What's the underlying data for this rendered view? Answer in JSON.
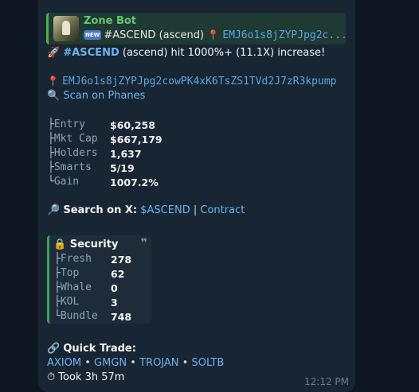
{
  "reply": {
    "bot_name": "Zone Bot",
    "new_badge": "NEW",
    "ticker_text": "#ASCEND (ascend)",
    "address_preview": "EMJ6o1s8jZYPJpg2c..."
  },
  "headline": {
    "rocket": "🚀",
    "ticker": "#ASCEND",
    "text": " (ascend) hit 1000%+ (11.1X) increase!"
  },
  "contract": {
    "pin": "📍",
    "address": "EMJ6o1s8jZYPJpg2cowPK4xK6TsZS1TVd2J7zR3kpump",
    "scan_icon": "🔍",
    "scan_link": "Scan on Phanes"
  },
  "stats": [
    {
      "prefix": "├",
      "key": "Entry",
      "value": "$60,258"
    },
    {
      "prefix": "├",
      "key": "Mkt Cap",
      "value": "$667,179"
    },
    {
      "prefix": "├",
      "key": "Holders",
      "value": "1,637"
    },
    {
      "prefix": "├",
      "key": "Smarts",
      "value": "5/19"
    },
    {
      "prefix": "└",
      "key": "Gain",
      "value": "1007.2%"
    }
  ],
  "search": {
    "icon": "🔎",
    "label": "Search on X:",
    "ticker_link": "$ASCEND",
    "divider": "|",
    "contract_link": "Contract"
  },
  "security": {
    "lock": "🔒",
    "title": "Security",
    "quote_mark": "❞",
    "items": [
      {
        "prefix": "├",
        "key": "Fresh",
        "value": "278"
      },
      {
        "prefix": "├",
        "key": "Top",
        "value": "62"
      },
      {
        "prefix": "├",
        "key": "Whale",
        "value": "0"
      },
      {
        "prefix": "├",
        "key": "KOL",
        "value": "3"
      },
      {
        "prefix": "└",
        "key": "Bundle",
        "value": "748"
      }
    ]
  },
  "quick_trade": {
    "icon": "🔗",
    "title": "Quick Trade:",
    "links": [
      "AXIOM",
      "GMGN",
      "TROJAN",
      "SOLTB"
    ],
    "separator": "•"
  },
  "took": {
    "icon": "⏱",
    "text": "Took 3h 57m"
  },
  "timestamp": "12:12 PM",
  "colors": {
    "background": "#0e1621",
    "bubble": "#182533",
    "link": "#6cb4f0",
    "bot_name": "#64c969",
    "pin": "#e0483e"
  }
}
